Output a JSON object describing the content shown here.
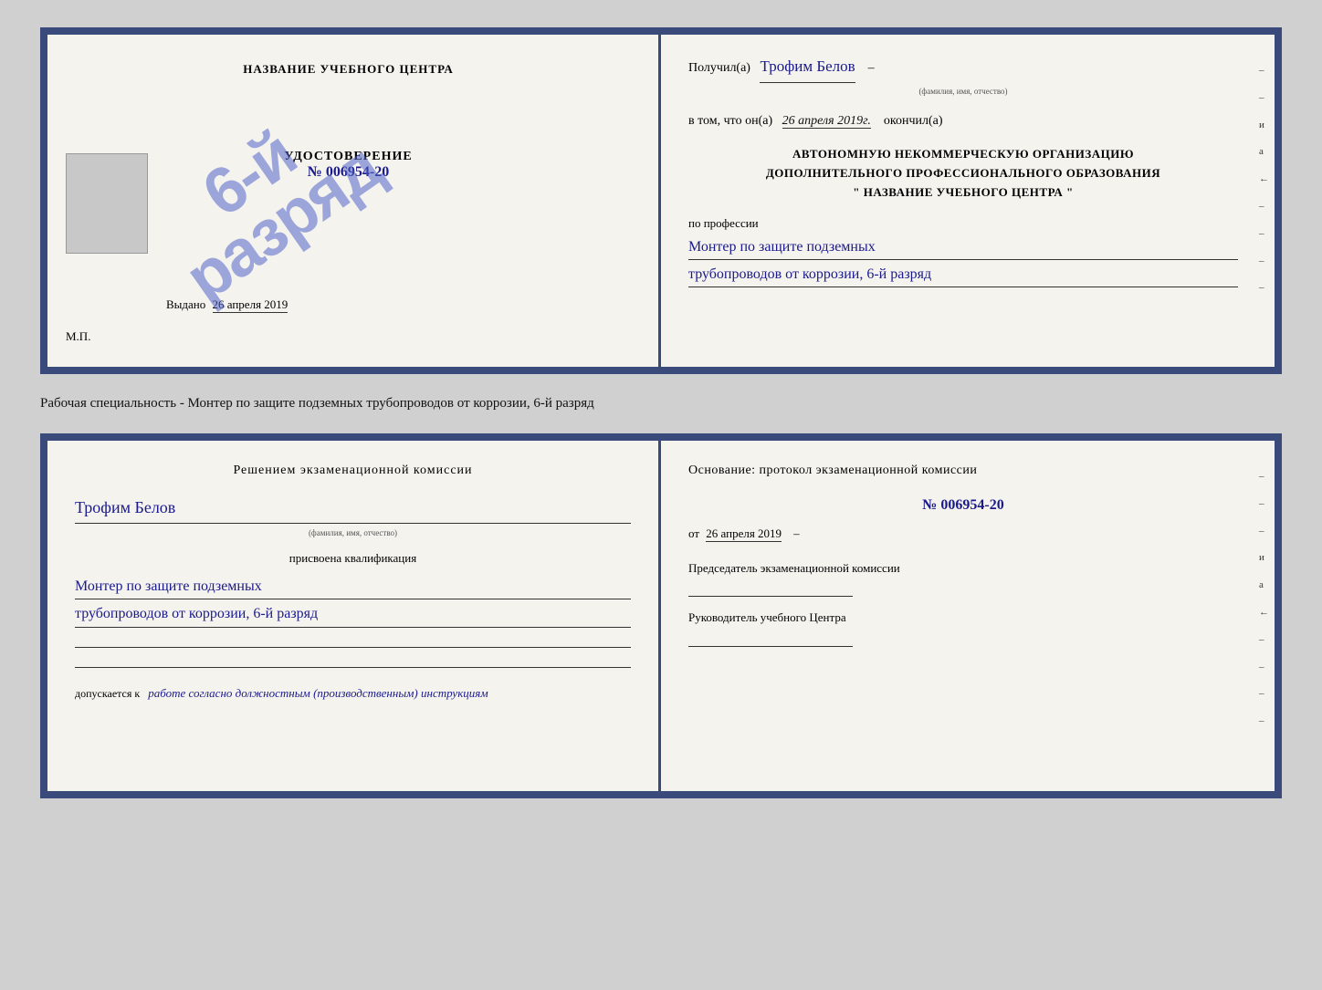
{
  "page": {
    "background": "#d0d0d0"
  },
  "top_cert": {
    "left": {
      "center_title": "НАЗВАНИЕ УЧЕБНОГО ЦЕНТРА",
      "udostoverenie_title": "УДОСТОВЕРЕНИЕ",
      "number": "№ 006954-20",
      "stamp_line1": "6-й",
      "stamp_line2": "разряд",
      "vydano_label": "Выдано",
      "vydano_date": "26 апреля 2019",
      "mp_label": "М.П."
    },
    "right": {
      "poluchil_label": "Получил(а)",
      "recipient_name": "Трофим Белов",
      "recipient_hint": "(фамилия, имя, отчество)",
      "dash1": "–",
      "vtom_label": "в том, что он(а)",
      "completion_date": "26 апреля 2019г.",
      "okончил_label": "окончил(а)",
      "org_line1": "АВТОНОМНУЮ НЕКОММЕРЧЕСКУЮ ОРГАНИЗАЦИЮ",
      "org_line2": "ДОПОЛНИТЕЛЬНОГО ПРОФЕССИОНАЛЬНОГО ОБРАЗОВАНИЯ",
      "org_name_open": "\"",
      "org_name": "НАЗВАНИЕ УЧЕБНОГО ЦЕНТРА",
      "org_name_close": "\"",
      "po_professii": "по профессии",
      "profession_line1": "Монтер по защите подземных",
      "profession_line2": "трубопроводов от коррозии, 6-й разряд",
      "side_chars": [
        "–",
        "–",
        "и",
        "а",
        "←",
        "–",
        "–",
        "–",
        "–"
      ]
    }
  },
  "specialty_text": "Рабочая специальность - Монтер по защите подземных трубопроводов от коррозии, 6-й разряд",
  "bottom_cert": {
    "left": {
      "decision_title": "Решением экзаменационной комиссии",
      "name": "Трофим Белов",
      "name_hint": "(фамилия, имя, отчество)",
      "prisvoena": "присвоена квалификация",
      "qualification_line1": "Монтер по защите подземных",
      "qualification_line2": "трубопроводов от коррозии, 6-й разряд",
      "dopuskaetsya_label": "допускается к",
      "dopusk_text": "работе согласно должностным (производственным) инструкциям"
    },
    "right": {
      "osnovanie": "Основание: протокол экзаменационной комиссии",
      "number": "№ 006954-20",
      "ot_label": "от",
      "ot_date": "26 апреля 2019",
      "chairman_label": "Председатель экзаменационной комиссии",
      "chief_label": "Руководитель учебного Центра",
      "side_chars": [
        "–",
        "–",
        "–",
        "и",
        "а",
        "←",
        "–",
        "–",
        "–",
        "–"
      ]
    }
  }
}
